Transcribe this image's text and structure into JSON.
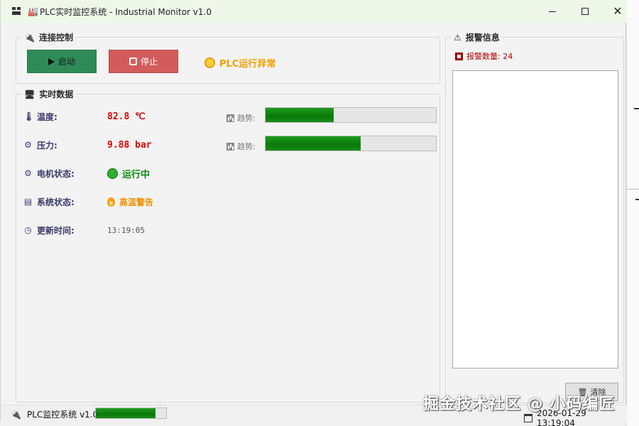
{
  "window": {
    "title": "PLC实时监控系统 - Industrial Monitor v1.0",
    "title_icon": "factory-icon"
  },
  "connection": {
    "group_title": "连接控制",
    "start_label": "启动",
    "stop_label": "停止",
    "plc_status": "PLC运行异常",
    "start_color": "#2e8b57",
    "stop_color": "#d45b5b",
    "status_color": "#f0a000"
  },
  "realtime": {
    "group_title": "实时数据",
    "temperature": {
      "label": "温度:",
      "value": "82.8 ℃",
      "trend_label": "趋势:",
      "trend_level": 0.4
    },
    "pressure": {
      "label": "压力:",
      "value": "9.88 bar",
      "trend_label": "趋势:",
      "trend_level": 0.56
    },
    "motor": {
      "label": "电机状态:",
      "value": "运行中"
    },
    "system": {
      "label": "系统状态:",
      "value": "高温警告"
    },
    "updated": {
      "label": "更新时间:",
      "value": "13:19:05"
    }
  },
  "alarm": {
    "group_title": "报警信息",
    "count_text": "报警数量: 24",
    "items": [],
    "clear_label": "清除"
  },
  "statusbar": {
    "app_label": "PLC监控系统 v1.0",
    "progress": 0.85,
    "datetime": "2026-01-29 13:19:04"
  },
  "watermark": "掘金技术社区 @ 小码编匠"
}
